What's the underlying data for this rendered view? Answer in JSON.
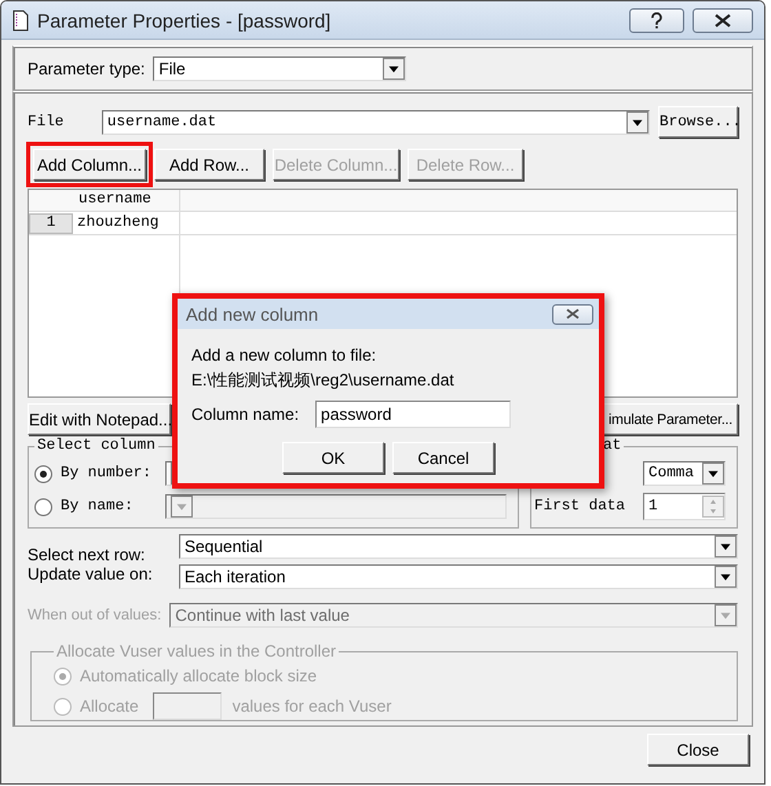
{
  "window": {
    "title": "Parameter Properties - [password]"
  },
  "parameter_type": {
    "label": "Parameter type:",
    "value": "File"
  },
  "file": {
    "label": "File",
    "value": "username.dat",
    "browse_button": "Browse..."
  },
  "table_buttons": [
    {
      "label": "Add Column...",
      "disabled": false,
      "highlighted": true
    },
    {
      "label": "Add Row...",
      "disabled": false,
      "highlighted": false
    },
    {
      "label": "Delete Column...",
      "disabled": true,
      "highlighted": false
    },
    {
      "label": "Delete Row...",
      "disabled": true,
      "highlighted": false
    }
  ],
  "table": {
    "columns": [
      "username"
    ],
    "rows": [
      {
        "number": "1",
        "cells": [
          "zhouzheng"
        ]
      }
    ]
  },
  "edit_button": "Edit with Notepad...",
  "simulate_button": "imulate Parameter...",
  "select_column": {
    "title": "Select column",
    "options": [
      {
        "label": "By number:",
        "selected": true
      },
      {
        "label": "By name:",
        "selected": false
      }
    ]
  },
  "file_format": {
    "title": "at",
    "delimiter": "Comma",
    "first_data_label": "First data",
    "first_data": "1"
  },
  "select_next_row": {
    "label": "Select next row:",
    "value": "Sequential"
  },
  "update_value_on": {
    "label": "Update value on:",
    "value": "Each iteration"
  },
  "when_out_of_values": {
    "label": "When out of values:",
    "value": "Continue with last value",
    "disabled": true
  },
  "allocate": {
    "title": "Allocate Vuser values in the Controller",
    "disabled": true,
    "options": [
      {
        "label": "Automatically allocate block size",
        "selected": true
      },
      {
        "label": "Allocate",
        "suffix": "values for each Vuser",
        "selected": false
      }
    ]
  },
  "close_button": "Close",
  "dialog": {
    "title": "Add new column",
    "highlighted": true,
    "message": "Add a new column to file:",
    "path": "E:\\性能测试视频\\reg2\\username.dat",
    "field_label": "Column name:",
    "field_value": "password",
    "buttons": [
      "OK",
      "Cancel"
    ]
  }
}
